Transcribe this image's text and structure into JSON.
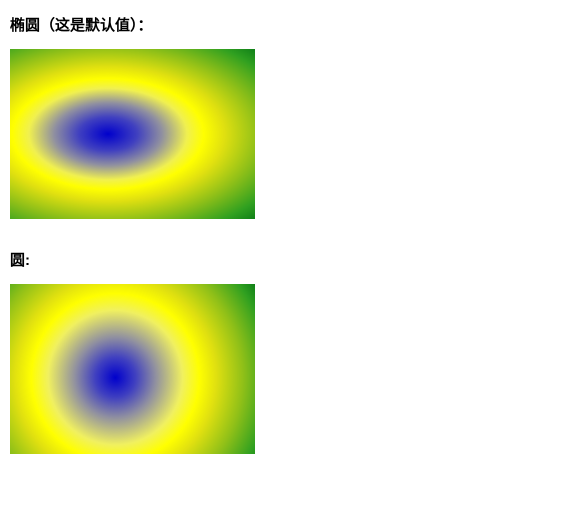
{
  "sections": [
    {
      "heading": "椭圆（这是默认值）："
    },
    {
      "heading": "圆:"
    }
  ]
}
